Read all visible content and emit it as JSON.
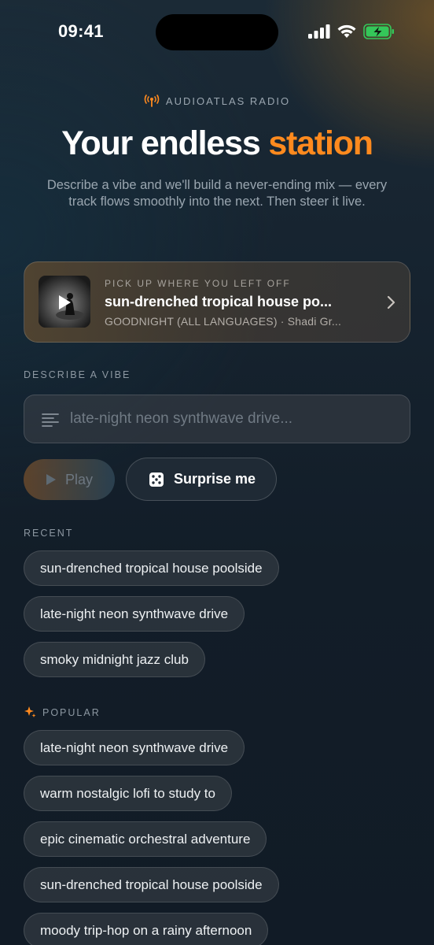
{
  "status_bar": {
    "time": "09:41"
  },
  "header": {
    "eyebrow": "AUDIOATLAS RADIO",
    "title_main": "Your endless",
    "title_accent": "station",
    "subtitle": "Describe a vibe and we'll build a never-ending mix — every track flows smoothly into the next. Then steer it live."
  },
  "resume": {
    "eyebrow": "PICK UP WHERE YOU LEFT OFF",
    "title": "sun-drenched tropical house po...",
    "subtitle": "GOODNIGHT (ALL LANGUAGES) · Shadi Gr..."
  },
  "describe": {
    "label": "DESCRIBE A VIBE",
    "placeholder": "late-night neon synthwave drive..."
  },
  "actions": {
    "play_label": "Play",
    "surprise_label": "Surprise me"
  },
  "recent": {
    "label": "RECENT",
    "items": [
      "sun-drenched tropical house poolside",
      "late-night neon synthwave drive",
      "smoky midnight jazz club"
    ]
  },
  "popular": {
    "label": "POPULAR",
    "items": [
      "late-night neon synthwave drive",
      "warm nostalgic lofi to study to",
      "epic cinematic orchestral adventure",
      "sun-drenched tropical house poolside",
      "moody trip-hop on a rainy afternoon"
    ]
  },
  "colors": {
    "accent": "#ff8a1e",
    "battery": "#34c759"
  },
  "icons": [
    "signal-icon",
    "wifi-icon",
    "battery-icon",
    "radio-icon",
    "play-icon",
    "chevron-right-icon",
    "text-lines-icon",
    "dice-icon",
    "sparkle-icon"
  ]
}
